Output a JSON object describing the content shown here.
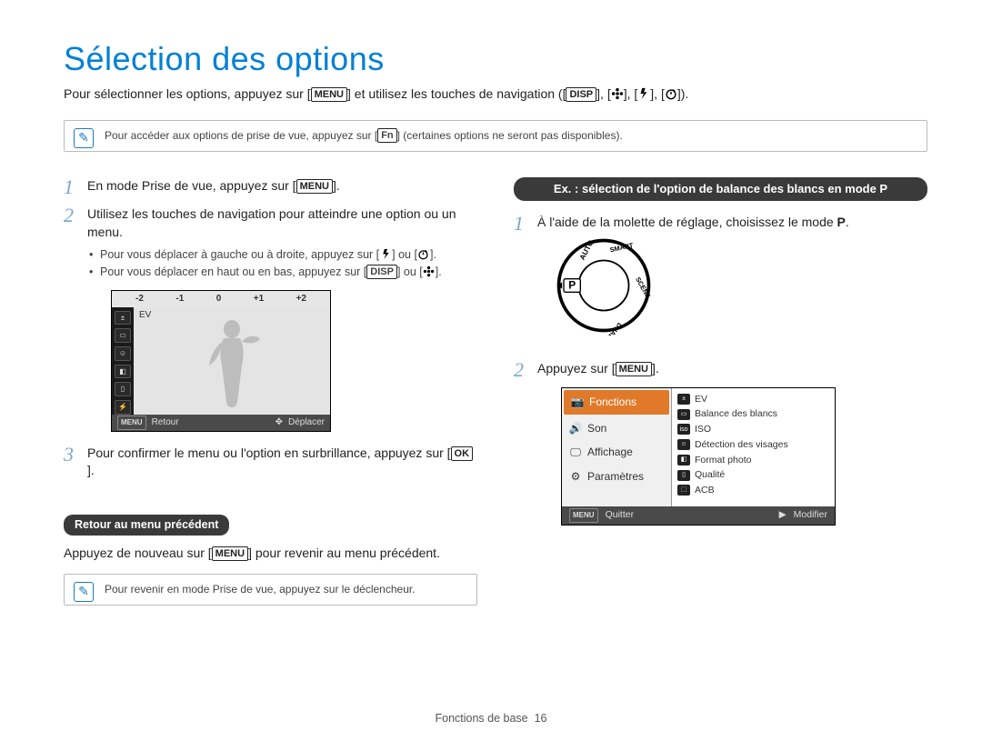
{
  "title": "Sélection des options",
  "intro_prefix": "Pour sélectionner les options, appuyez sur [",
  "intro_middle": "] et utilisez les touches de navigation ([",
  "intro_sep": "], [",
  "intro_suffix": "]).",
  "badges": {
    "menu": "MENU",
    "disp": "DISP",
    "fn": "Fn",
    "ok": "OK"
  },
  "icons": {
    "flower": "flower-icon",
    "flash": "flash-icon",
    "timer": "timer-icon"
  },
  "note1_prefix": "Pour accéder aux options de prise de vue, appuyez sur [",
  "note1_suffix": "] (certaines options ne seront pas disponibles).",
  "steps_left": {
    "s1_a": "En mode Prise de vue, appuyez sur [",
    "s1_b": "].",
    "s2": "Utilisez les touches de navigation pour atteindre une option ou un menu.",
    "s2_b1_a": "Pour vous déplacer à gauche ou à droite, appuyez sur [",
    "s2_b1_mid": "] ou [",
    "s2_b1_b": "].",
    "s2_b2_a": "Pour vous déplacer en haut ou en bas, appuyez sur [",
    "s2_b2_mid": "] ou [",
    "s2_b2_b": "].",
    "s3_a": "Pour confirmer le menu ou l'option en surbrillance, appuyez sur [",
    "s3_b": "]."
  },
  "lcd": {
    "ticks": {
      "m2": "-2",
      "m1": "-1",
      "z": "0",
      "p1": "+1",
      "p2": "+2"
    },
    "ev": "EV",
    "foot_menu": "MENU",
    "foot_back": "Retour",
    "foot_nav": "✥",
    "foot_move": "Déplacer"
  },
  "prev_menu_heading": "Retour au menu précédent",
  "prev_menu_text_a": "Appuyez de nouveau sur [",
  "prev_menu_text_b": "] pour revenir au menu précédent.",
  "note2": "Pour revenir en mode Prise de vue, appuyez sur le déclencheur.",
  "right_heading": "Ex. : sélection de l'option de balance des blancs en mode P",
  "steps_right": {
    "s1_a": "À l'aide de la molette de réglage, choisissez le mode ",
    "s1_mode": "P",
    "s1_b": ".",
    "s2_a": "Appuyez sur [",
    "s2_b": "]."
  },
  "dial_labels": {
    "p": "P",
    "auto": "AUTO",
    "smart": "SMART",
    "scene": "SCENE",
    "dual": "DUAL"
  },
  "menu": {
    "left": [
      {
        "icon": "camera",
        "label": "Fonctions",
        "selected": true
      },
      {
        "icon": "sound",
        "label": "Son",
        "selected": false
      },
      {
        "icon": "display",
        "label": "Affichage",
        "selected": false
      },
      {
        "icon": "gear",
        "label": "Paramètres",
        "selected": false
      }
    ],
    "right": [
      {
        "icon": "ev",
        "label": "EV"
      },
      {
        "icon": "wb",
        "label": "Balance des blancs"
      },
      {
        "icon": "iso",
        "label": "ISO"
      },
      {
        "icon": "face",
        "label": "Détection des visages"
      },
      {
        "icon": "size",
        "label": "Format photo"
      },
      {
        "icon": "qual",
        "label": "Qualité"
      },
      {
        "icon": "acb",
        "label": "ACB"
      }
    ],
    "foot_menu": "MENU",
    "foot_quit": "Quitter",
    "foot_arrow": "▶",
    "foot_modify": "Modifier"
  },
  "footer_section": "Fonctions de base",
  "footer_page": "16"
}
